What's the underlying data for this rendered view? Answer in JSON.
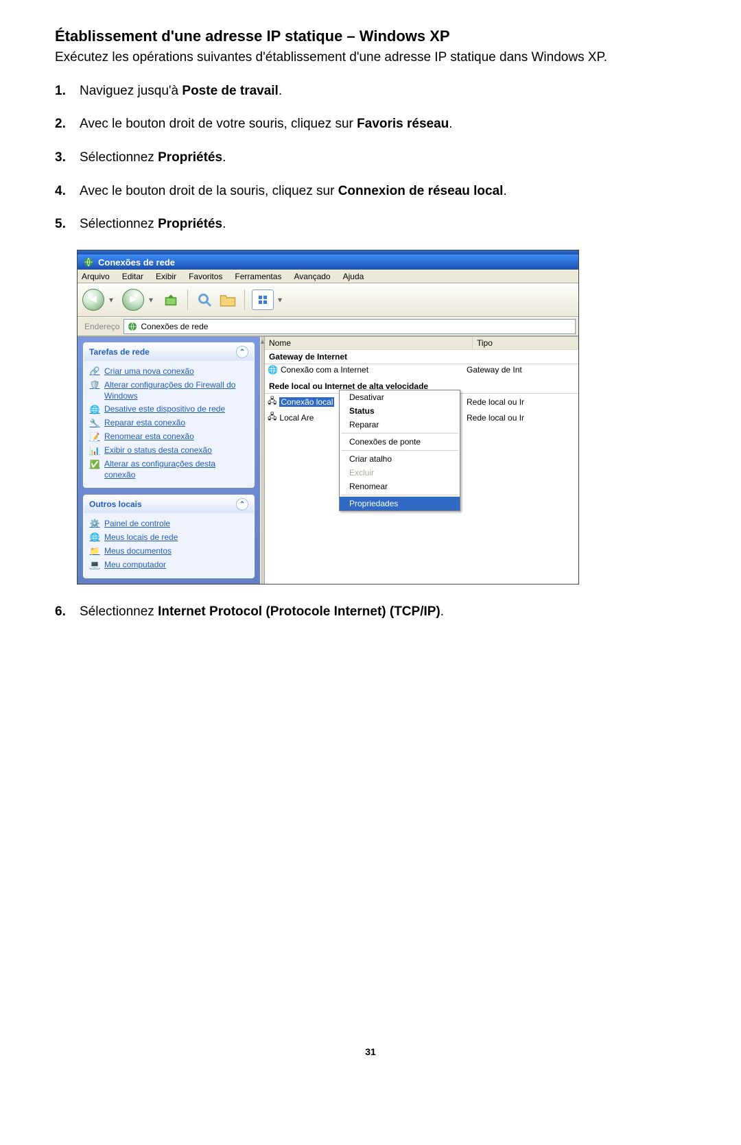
{
  "doc": {
    "heading": "Établissement d'une adresse IP statique – Windows XP",
    "intro": "Exécutez les opérations suivantes d'établissement d'une adresse IP statique dans Windows XP.",
    "steps": [
      {
        "n": "1.",
        "pre": "Naviguez jusqu'à ",
        "b": "Poste de travail",
        "post": "."
      },
      {
        "n": "2.",
        "pre": "Avec le bouton droit de votre souris, cliquez sur ",
        "b": "Favoris réseau",
        "post": "."
      },
      {
        "n": "3.",
        "pre": "Sélectionnez ",
        "b": "Propriétés",
        "post": "."
      },
      {
        "n": "4.",
        "pre": "Avec le bouton droit de la souris, cliquez sur ",
        "b": "Connexion de réseau local",
        "post": "."
      },
      {
        "n": "5.",
        "pre": "Sélectionnez ",
        "b": "Propriétés",
        "post": "."
      },
      {
        "n": "6.",
        "pre": "Sélectionnez ",
        "b": "Internet Protocol (Protocole Internet) (TCP/IP)",
        "post": "."
      }
    ],
    "page_number": "31"
  },
  "window": {
    "title": "Conexões de rede",
    "menu": [
      "Arquivo",
      "Editar",
      "Exibir",
      "Favoritos",
      "Ferramentas",
      "Avançado",
      "Ajuda"
    ],
    "address_label": "Endereço",
    "address_value": "Conexões de rede",
    "columns": {
      "name": "Nome",
      "type": "Tipo"
    },
    "group1": "Gateway de Internet",
    "group2": "Rede local ou Internet de alta velocidade",
    "rows": [
      {
        "name": "Conexão com a Internet",
        "type": "Gateway de Int"
      },
      {
        "name": "Conexão local",
        "type": "Rede local ou Ir"
      },
      {
        "name": "Local Are",
        "type": "Rede local ou Ir"
      }
    ],
    "context_menu": [
      "Desativar",
      "Status",
      "Reparar",
      "Conexões de ponte",
      "Criar atalho",
      "Excluir",
      "Renomear",
      "Propriedades"
    ],
    "sidebar": {
      "tasks_title": "Tarefas de rede",
      "tasks": [
        "Criar uma nova conexão",
        "Alterar configurações do Firewall do Windows",
        "Desative este dispositivo de rede",
        "Reparar esta conexão",
        "Renomear esta conexão",
        "Exibir o status desta conexão",
        "Alterar as configurações desta conexão"
      ],
      "other_title": "Outros locais",
      "other": [
        "Painel de controle",
        "Meus locais de rede",
        "Meus documentos",
        "Meu computador"
      ]
    }
  }
}
